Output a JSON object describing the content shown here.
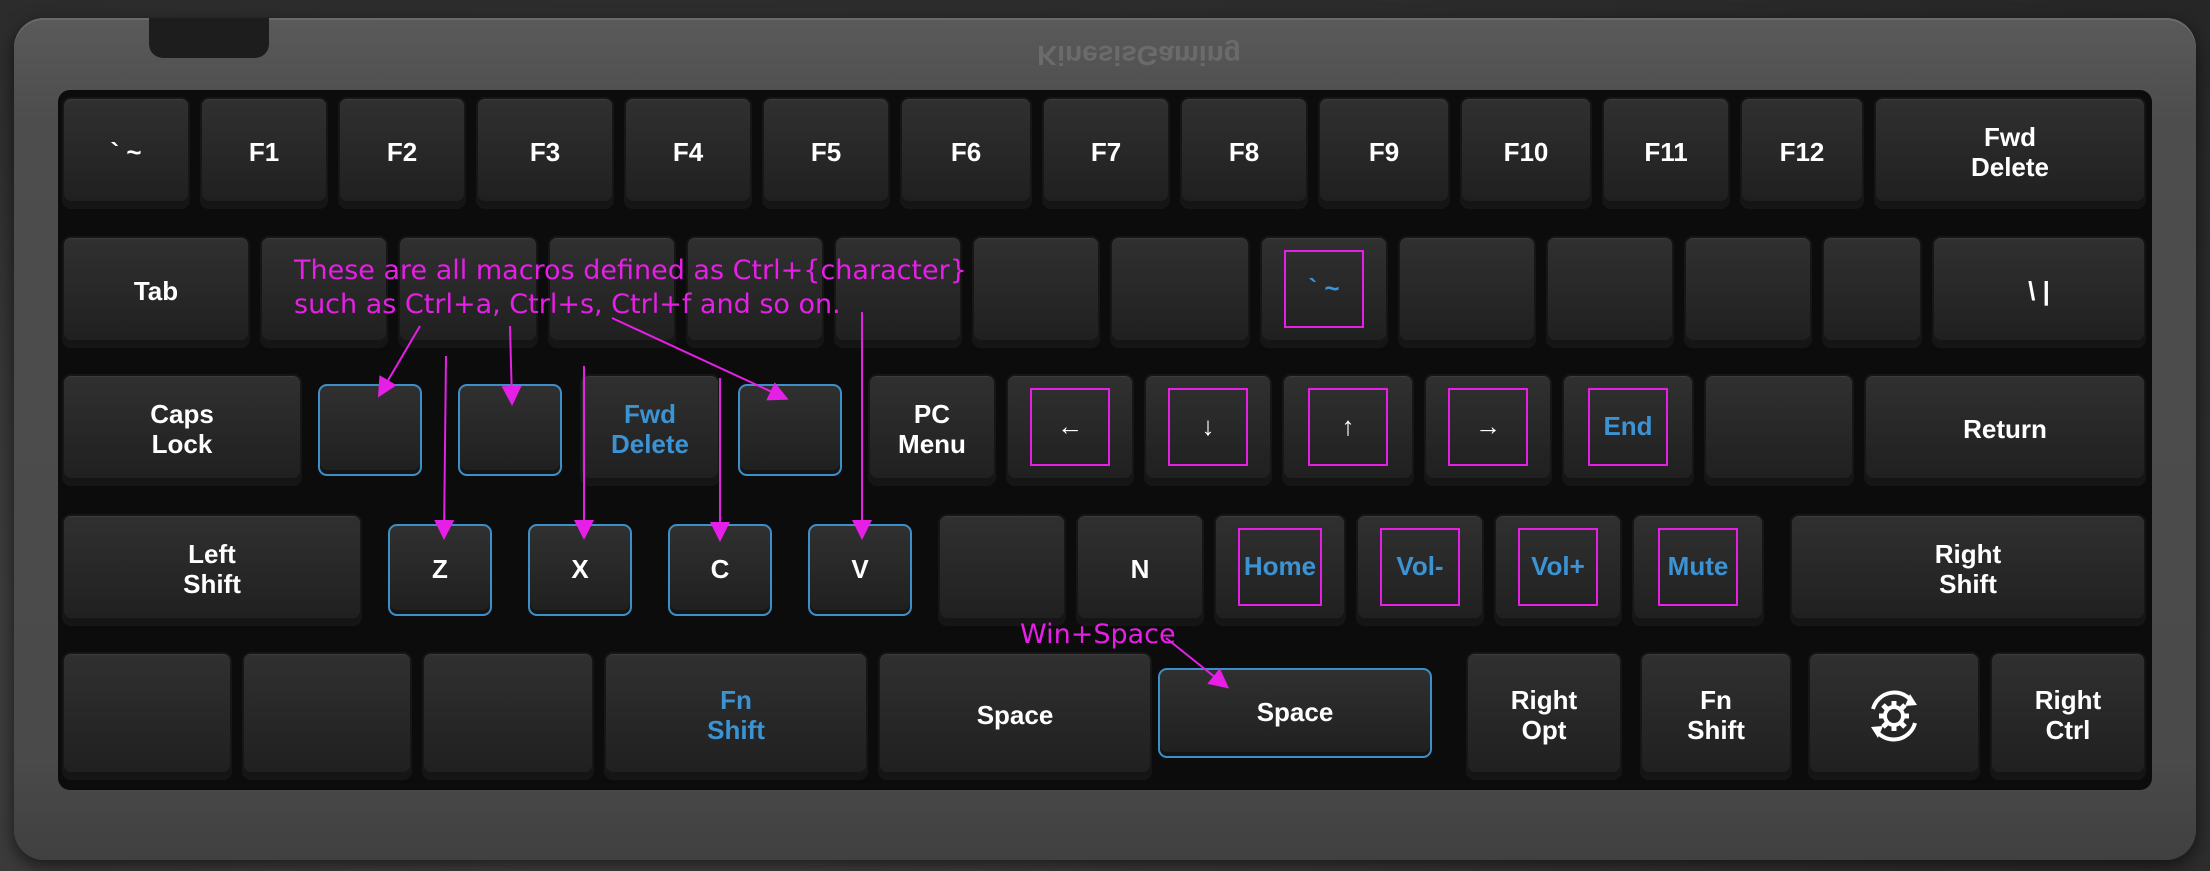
{
  "brand": "KinesisGaming",
  "colors": {
    "accent_blue": "#3b93d4",
    "annotation_magenta": "#e61fe6",
    "key_text": "#ffffff"
  },
  "keys": {
    "r1": [
      "` ~",
      "F1",
      "F2",
      "F3",
      "F4",
      "F5",
      "F6",
      "F7",
      "F8",
      "F9",
      "F10",
      "F11",
      "F12",
      "Fwd\nDelete"
    ],
    "r2": [
      "Tab",
      "",
      "",
      "",
      "",
      "",
      "",
      "",
      "` ~",
      "",
      "",
      "",
      "",
      "\\ |"
    ],
    "r3": [
      "Caps\nLock",
      "",
      "",
      "Fwd\nDelete",
      "",
      "PC\nMenu",
      "←",
      "↓",
      "↑",
      "→",
      "End",
      "",
      "Return"
    ],
    "r4": [
      "Left\nShift",
      "Z",
      "X",
      "C",
      "V",
      "",
      "N",
      "Home",
      "Vol-",
      "Vol+",
      "Mute",
      "Right\nShift"
    ],
    "r5": [
      "",
      "",
      "",
      "Fn\nShift",
      "Space",
      "Space",
      "Right\nOpt",
      "Fn\nShift",
      "",
      "Right\nCtrl"
    ]
  },
  "annotations": {
    "macros_line1": "These are all macros defined as Ctrl+{character}",
    "macros_line2": "such as Ctrl+a, Ctrl+s, Ctrl+f and so on.",
    "win_space": "Win+Space"
  },
  "icons": {
    "settings": "gear-icon"
  }
}
